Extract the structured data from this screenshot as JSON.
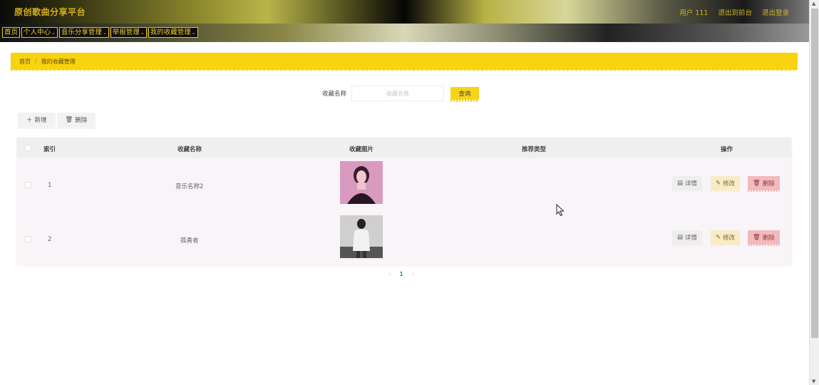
{
  "header": {
    "title": "原创歌曲分享平台",
    "user": "用户 111",
    "back_link": "退出到前台",
    "logout": "退出登录"
  },
  "nav": {
    "items": [
      {
        "label": "首页",
        "caret": ""
      },
      {
        "label": "个人中心",
        "caret": "⌄"
      },
      {
        "label": "音乐分享管理",
        "caret": "⌄"
      },
      {
        "label": "举报管理",
        "caret": "⌄"
      },
      {
        "label": "我的收藏管理",
        "caret": "⌄"
      }
    ]
  },
  "breadcrumb": {
    "home": "首页",
    "separator": "/",
    "current": "我的收藏管理"
  },
  "search": {
    "label": "收藏名称",
    "placeholder": "收藏名称",
    "value": "",
    "button": "查询"
  },
  "actions": {
    "add_icon": "plus-icon",
    "add": "新增",
    "delete_icon": "trash-icon",
    "delete": "删除"
  },
  "table": {
    "columns": {
      "index": "索引",
      "name": "收藏名称",
      "image": "收藏图片",
      "type": "推荐类型",
      "ops": "操作"
    },
    "rows": [
      {
        "index": "1",
        "name": "音乐名称2",
        "type": "",
        "image": "portrait-pink"
      },
      {
        "index": "2",
        "name": "孤勇者",
        "type": "",
        "image": "portrait-street"
      }
    ],
    "ops": {
      "detail": "详情",
      "edit": "修改",
      "delete": "删除"
    }
  },
  "pagination": {
    "prev": "‹",
    "current": "1",
    "next": "›"
  },
  "colors": {
    "accent": "#f9d30d",
    "title_text": "#d6b01c",
    "danger": "#f3b9bd",
    "edit": "#f7ecc5"
  }
}
